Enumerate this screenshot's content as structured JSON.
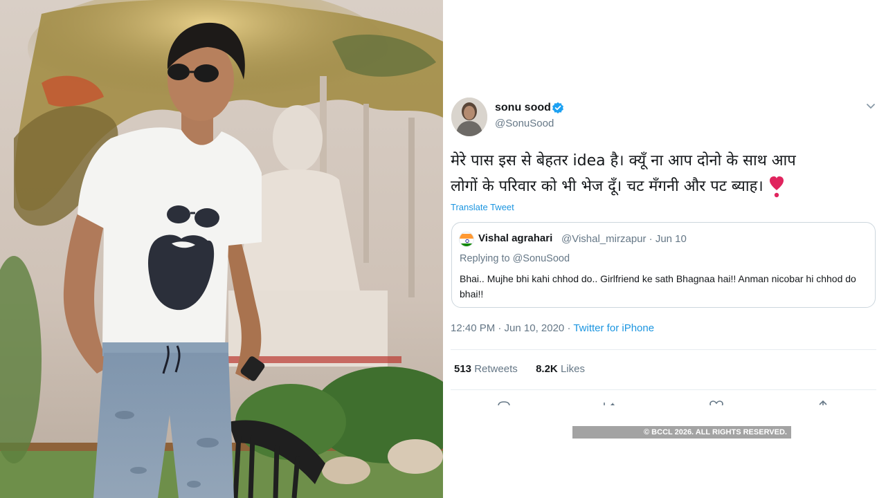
{
  "tweet": {
    "display_name": "sonu sood",
    "handle": "@SonuSood",
    "text_lines": [
      "मेरे पास इस से बेहतर idea है। क्यूँ ना आप दोनो के साथ आप",
      "लोगों के परिवार को भी भेज दूँ। चट मँगनी और पट ब्याह।"
    ],
    "translate_label": "Translate Tweet",
    "timestamp": "12:40 PM · Jun 10, 2020 · ",
    "source": "Twitter for iPhone",
    "retweets_count": "513",
    "retweets_label": "Retweets",
    "likes_count": "8.2K",
    "likes_label": "Likes"
  },
  "quoted_tweet": {
    "display_name": "Vishal agrahari",
    "handle_date": "@Vishal_mirzapur · Jun 10",
    "replying_to": "Replying to @SonuSood",
    "text": "Bhai.. Mujhe bhi kahi chhod do.. Girlfriend ke sath Bhagnaa hai!! Anman nicobar hi chhod do bhai!!"
  },
  "footer": {
    "copyright": "© BCCL 2026. ALL RIGHTS RESERVED."
  },
  "colors": {
    "link_blue": "#1b95e0",
    "secondary_text": "#657786",
    "primary_text": "#14171a",
    "verified_blue": "#1da1f2",
    "heart_red": "#e0245e"
  },
  "icons": [
    "verified-badge-icon",
    "chevron-down-icon",
    "heart-emoji-icon",
    "reply-icon",
    "retweet-icon",
    "like-icon",
    "share-icon"
  ]
}
